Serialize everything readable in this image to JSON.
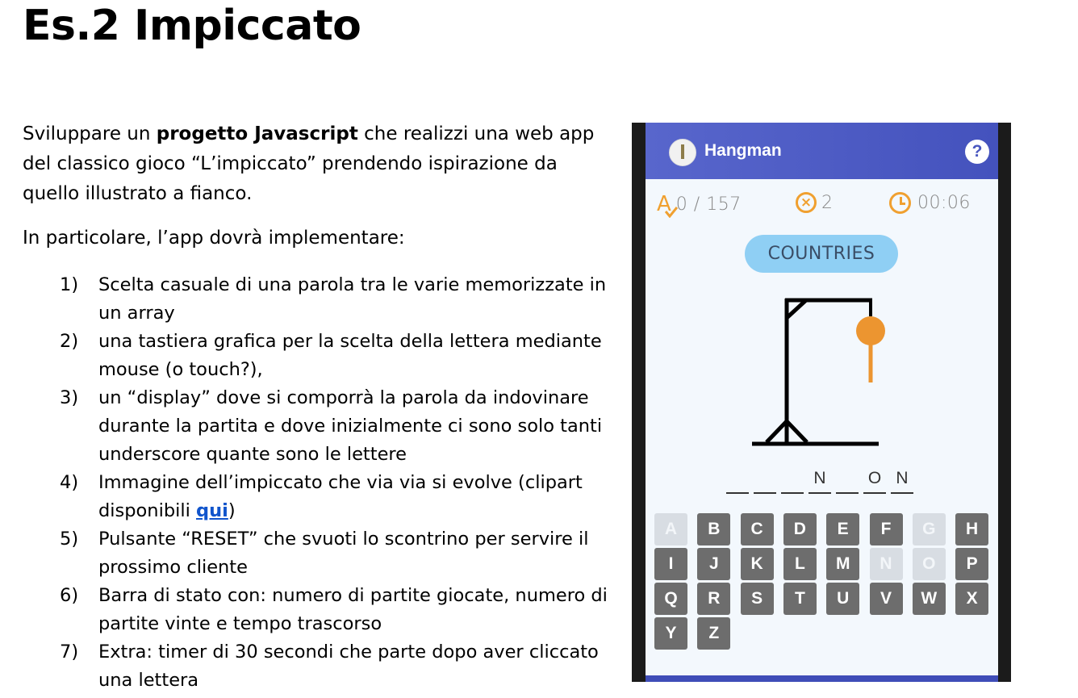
{
  "title": "Es.2 Impiccato",
  "intro": {
    "part1": "Sviluppare un ",
    "bold": "progetto Javascript",
    "part2": "  che realizzi una web app del classico gioco “L’impiccato” prendendo ispirazione da quello illustrato a fianco."
  },
  "subheading": "In particolare, l’app dovrà implementare:",
  "requirements": [
    {
      "num": "1)",
      "text": "Scelta casuale di una parola tra le varie memorizzate in un array"
    },
    {
      "num": "2)",
      "text": "una tastiera grafica per la scelta della lettera mediante mouse (o touch?),"
    },
    {
      "num": "3)",
      "text": "un “display” dove si comporrà la parola da indovinare durante la partita e dove inizialmente ci sono solo tanti underscore quante sono le lettere"
    },
    {
      "num": "4)",
      "text_before": "Immagine dell’impiccato che via via si evolve (clipart disponibili ",
      "link": "qui",
      "text_after": ")"
    },
    {
      "num": "5)",
      "text": "Pulsante “RESET” che svuoti lo scontrino per servire il prossimo cliente"
    },
    {
      "num": "6)",
      "text": "Barra di stato con: numero di partite giocate, numero di partite vinte e tempo trascorso"
    },
    {
      "num": "7)",
      "text": "Extra: timer di 30 secondi che parte dopo aver cliccato una lettera"
    }
  ],
  "app": {
    "title": "Hangman",
    "help_icon": "question-icon",
    "help_label": "?",
    "stats": {
      "score": "0 / 157",
      "errors": "2",
      "time": "00:06"
    },
    "category": "COUNTRIES",
    "word_slots": [
      "",
      "",
      "",
      "N",
      "",
      "O",
      "N"
    ],
    "keyboard": [
      {
        "letter": "A",
        "used": true
      },
      {
        "letter": "B",
        "used": false
      },
      {
        "letter": "C",
        "used": false
      },
      {
        "letter": "D",
        "used": false
      },
      {
        "letter": "E",
        "used": false
      },
      {
        "letter": "F",
        "used": false
      },
      {
        "letter": "G",
        "used": true
      },
      {
        "letter": "H",
        "used": false
      },
      {
        "letter": "I",
        "used": false
      },
      {
        "letter": "J",
        "used": false
      },
      {
        "letter": "K",
        "used": false
      },
      {
        "letter": "L",
        "used": false
      },
      {
        "letter": "M",
        "used": false
      },
      {
        "letter": "N",
        "used": true
      },
      {
        "letter": "O",
        "used": true
      },
      {
        "letter": "P",
        "used": false
      },
      {
        "letter": "Q",
        "used": false
      },
      {
        "letter": "R",
        "used": false
      },
      {
        "letter": "S",
        "used": false
      },
      {
        "letter": "T",
        "used": false
      },
      {
        "letter": "U",
        "used": false
      },
      {
        "letter": "V",
        "used": false
      },
      {
        "letter": "W",
        "used": false
      },
      {
        "letter": "X",
        "used": false
      },
      {
        "letter": "Y",
        "used": false
      },
      {
        "letter": "Z",
        "used": false
      }
    ],
    "colors": {
      "appbar": "#4a58c0",
      "accent": "#f0a030",
      "category_bg": "#8fcff4",
      "key": "#6d6d6d",
      "key_used": "#d8dde3"
    }
  }
}
